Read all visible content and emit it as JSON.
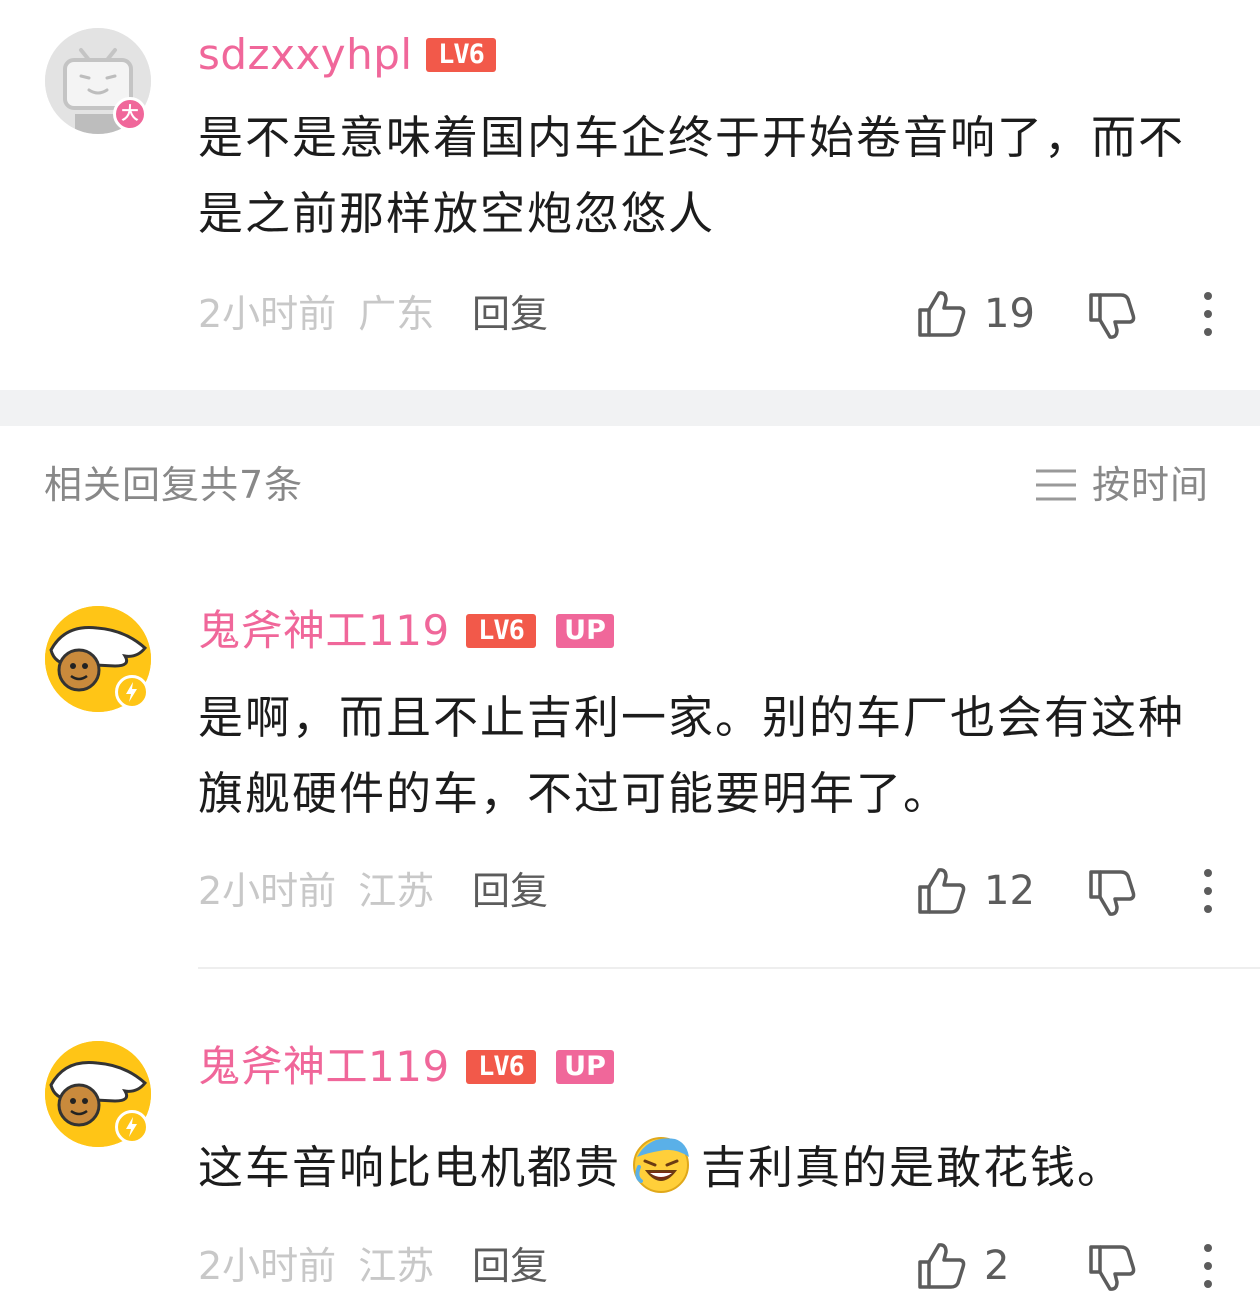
{
  "main_comment": {
    "username": "sdzxxyhpl",
    "level": "LV6",
    "avatar_badge": "大",
    "content": "是不是意味着国内车企终于开始卷音响了，而不是之前那样放空炮忽悠人",
    "time": "2小时前",
    "location": "广东",
    "reply_label": "回复",
    "like_count": "19"
  },
  "replies_header": {
    "title": "相关回复共7条",
    "sort_label": "按时间"
  },
  "replies": [
    {
      "username": "鬼斧神工119",
      "level": "LV6",
      "up_badge": "UP",
      "content": "是啊，而且不止吉利一家。别的车厂也会有这种旗舰硬件的车，不过可能要明年了。",
      "time": "2小时前",
      "location": "江苏",
      "reply_label": "回复",
      "like_count": "12"
    },
    {
      "username": "鬼斧神工119",
      "level": "LV6",
      "up_badge": "UP",
      "content_before_emoji": "这车音响比电机都贵",
      "emoji": "laughing-crying-emoji",
      "content_after_emoji": "吉利真的是敢花钱。",
      "time": "2小时前",
      "location": "江苏",
      "reply_label": "回复",
      "like_count": "2"
    }
  ],
  "colors": {
    "username_pink": "#f0679a",
    "level_red": "#f2594a",
    "up_pink": "#f0679a",
    "text_dark": "#1c1c1c",
    "meta_gray": "#c8c8c8",
    "avatar_yellow": "#ffc516",
    "section_gap": "#f1f2f3"
  }
}
